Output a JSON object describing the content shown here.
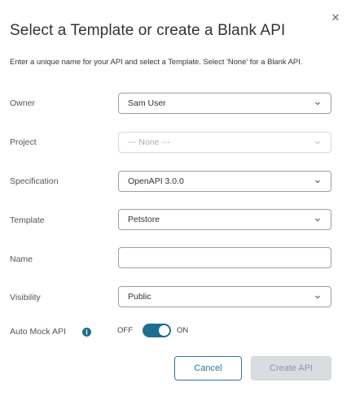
{
  "dialog": {
    "title": "Select a Template or create a Blank API",
    "subtitle": "Enter a unique name for your API and select a Template. Select 'None' for a Blank API.",
    "close_icon": "close-icon"
  },
  "fields": {
    "owner": {
      "label": "Owner",
      "value": "Sam User"
    },
    "project": {
      "label": "Project",
      "value": "--- None ---"
    },
    "specification": {
      "label": "Specification",
      "value": "OpenAPI 3.0.0"
    },
    "template": {
      "label": "Template",
      "value": "Petstore"
    },
    "name": {
      "label": "Name",
      "value": ""
    },
    "visibility": {
      "label": "Visibility",
      "value": "Public"
    },
    "auto_mock": {
      "label": "Auto Mock API",
      "off_label": "OFF",
      "on_label": "ON",
      "state": "on"
    }
  },
  "buttons": {
    "cancel": "Cancel",
    "create": "Create API"
  },
  "colors": {
    "accent": "#1d6f8f",
    "cancel_border": "#2a7a9a",
    "disabled_button": "#d9dde1"
  }
}
